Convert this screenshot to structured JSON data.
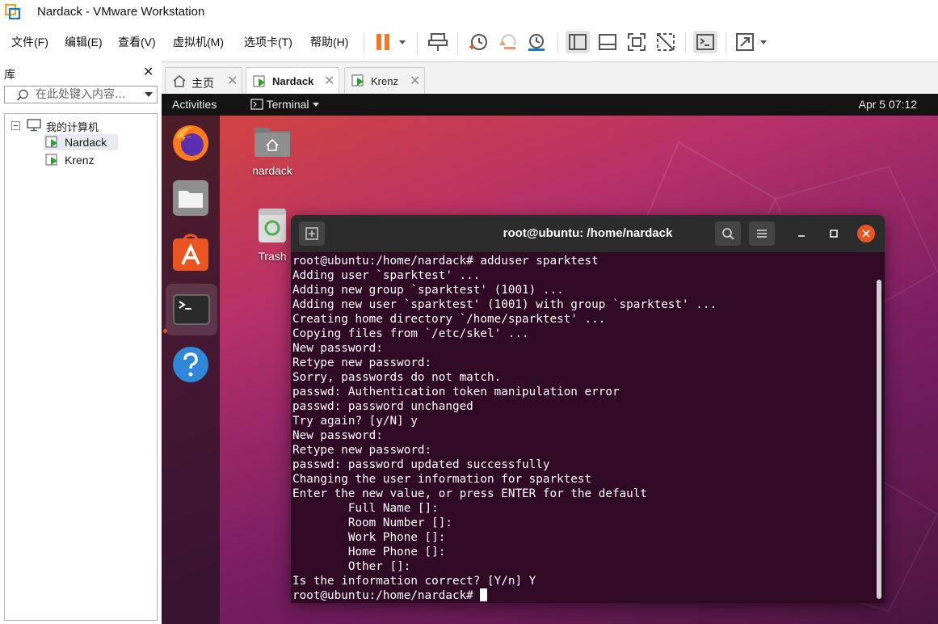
{
  "window": {
    "title": "Nardack - VMware Workstation"
  },
  "menu": [
    "文件(F)",
    "编辑(E)",
    "查看(V)",
    "虚拟机(M)",
    "选项卡(T)",
    "帮助(H)"
  ],
  "toolbar": {
    "icons": [
      "pause-icon",
      "send-ctrl-alt-del-icon",
      "snapshot-icon",
      "revert-snapshot-icon",
      "snapshot-manager-icon",
      "show-library-icon",
      "thumbnail-bar-icon",
      "full-screen-icon",
      "unity-icon",
      "console-view-icon",
      "stretch-guest-icon"
    ]
  },
  "library": {
    "title": "库",
    "search_placeholder": "在此处键入内容...",
    "tree": {
      "root": "我的计算机",
      "vms": [
        "Nardack",
        "Krenz"
      ],
      "selected": "Nardack"
    }
  },
  "tabs": [
    {
      "label": "主页",
      "icon": "home-icon"
    },
    {
      "label": "Nardack",
      "icon": "vm-running-icon",
      "active": true
    },
    {
      "label": "Krenz",
      "icon": "vm-running-icon"
    }
  ],
  "guest": {
    "topbar": {
      "activities": "Activities",
      "app_menu": "Terminal",
      "clock": "Apr 5  07:12"
    },
    "dock": [
      "firefox-icon",
      "files-icon",
      "ubuntu-software-icon",
      "terminal-icon",
      "help-icon"
    ],
    "desktop_icons": [
      {
        "label": "nardack",
        "icon": "home-folder-icon"
      },
      {
        "label": "Trash",
        "icon": "trash-icon"
      }
    ],
    "terminal": {
      "title": "root@ubuntu: /home/nardack",
      "lines": [
        "root@ubuntu:/home/nardack# adduser sparktest",
        "Adding user `sparktest' ...",
        "Adding new group `sparktest' (1001) ...",
        "Adding new user `sparktest' (1001) with group `sparktest' ...",
        "Creating home directory `/home/sparktest' ...",
        "Copying files from `/etc/skel' ...",
        "New password:",
        "Retype new password:",
        "Sorry, passwords do not match.",
        "passwd: Authentication token manipulation error",
        "passwd: password unchanged",
        "Try again? [y/N] y",
        "New password:",
        "Retype new password:",
        "passwd: password updated successfully",
        "Changing the user information for sparktest",
        "Enter the new value, or press ENTER for the default",
        "        Full Name []:",
        "        Room Number []:",
        "        Work Phone []:",
        "        Home Phone []:",
        "        Other []:",
        "Is the information correct? [Y/n] Y"
      ],
      "prompt": "root@ubuntu:/home/nardack# "
    }
  },
  "colors": {
    "terminal_bg": "#300a24",
    "ubuntu_orange": "#e95420",
    "pause_orange": "#f07a2a"
  }
}
